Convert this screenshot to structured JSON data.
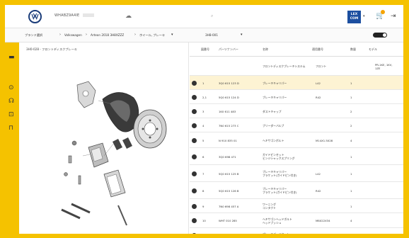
{
  "header": {
    "brand_name": "WHABZ9A4IE",
    "lexcom": "LEX COM"
  },
  "breadcrumb": {
    "items": [
      "ブランド選択",
      "Volkswagen",
      "Arteon 2018 3H8XZZZ",
      "ホイール, ブレーキ",
      "システム"
    ],
    "filter_label": "3H8-001"
  },
  "left_pane": {
    "title": "3H0-028 - フロントディスクブレーキ"
  },
  "table": {
    "headers": [
      "図番号",
      "パーツナンバー",
      "名称",
      "適用番号",
      "数量",
      "モデル"
    ],
    "top_row": {
      "name": "フロントディスクブレーキシステム",
      "status": "フロント",
      "model": "PR-1KE, 1KV, 1ZE"
    },
    "rows": [
      {
        "num": "1",
        "part": "3Q0 615 123 D",
        "name": "ブレーキキャリパー",
        "spec": "L42",
        "qty": "1",
        "model": ""
      },
      {
        "num": "2,1",
        "part": "5Q0 615 124 D",
        "name": "ブレーキキャリパー",
        "spec": "R42",
        "qty": "1",
        "model": ""
      },
      {
        "num": "3",
        "part": "1K0 611 483",
        "name": "ダストキャップ",
        "spec": "",
        "qty": "2",
        "model": ""
      },
      {
        "num": "4",
        "part": "7N0 615 273 C",
        "name": "ブリーダーバルブ",
        "spec": "",
        "qty": "2",
        "model": ""
      },
      {
        "num": "5",
        "part": "N 910 835 01",
        "name": "ヘキサゴンボルト",
        "spec": "M14X1.5X28",
        "qty": "4",
        "model": ""
      },
      {
        "num": "6",
        "part": "3Q0 698 471",
        "name": "ガイドピンセット\nヒンジシャックスプリング",
        "spec": "",
        "qty": "1",
        "model": ""
      },
      {
        "num": "7",
        "part": "5Q0 615 125 B",
        "name": "ブレーキキャリパー\nブラケット(ガイドピン付き)",
        "spec": "L42",
        "qty": "1",
        "model": ""
      },
      {
        "num": "8",
        "part": "5Q0 615 126 B",
        "name": "ブレーキキャリパー\nブラケット(ガイドピン付き)",
        "spec": "R42",
        "qty": "1",
        "model": ""
      },
      {
        "num": "9",
        "part": "7N0 698 457 A",
        "name": "ワーニング\nコンタクト",
        "spec": "",
        "qty": "1",
        "model": ""
      },
      {
        "num": "10",
        "part": "WHT 010 285",
        "name": "ヘキサゴンヘッドボルト\nヘッドブッシュ",
        "spec": "M8X22X34",
        "qty": "4",
        "model": ""
      },
      {
        "num": "11",
        "part": "5Q0 698 151 AH",
        "name": "ブレーキパッドセット\nインナーパッド",
        "spec": "フロント",
        "qty": "1",
        "model": "PR-1KE"
      }
    ]
  }
}
